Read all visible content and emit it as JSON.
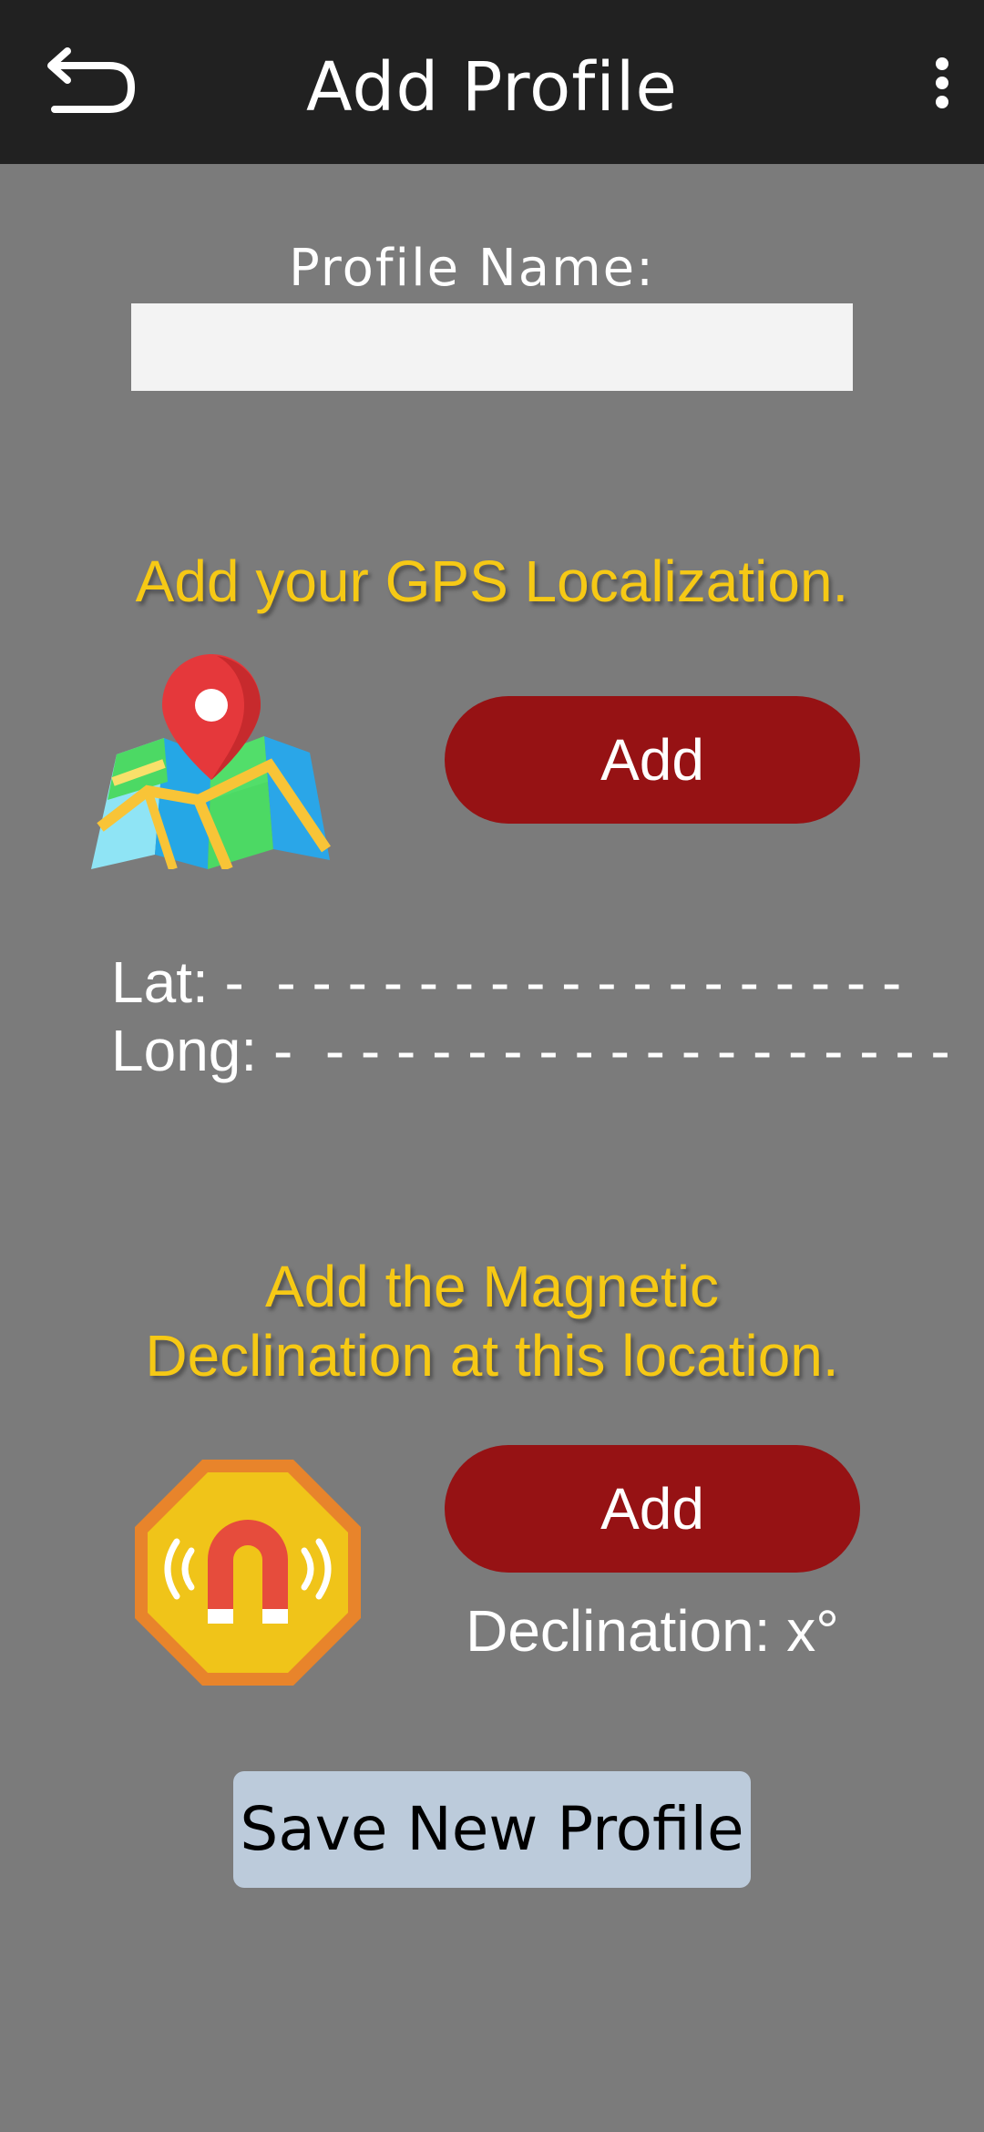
{
  "header": {
    "title": "Add Profile",
    "back_icon": "back-arrow-icon",
    "menu_icon": "more-vertical-icon"
  },
  "profile": {
    "label": "Profile Name:",
    "value": "",
    "placeholder": ""
  },
  "gps": {
    "heading": "Add your GPS Localization.",
    "icon": "map-pin-icon",
    "add_label": "Add",
    "lat_text": "Lat: -  - - - - - - - - - - - - - - - - - -",
    "long_text": "Long: -  - - - - - - - - - - - - - - - - - -"
  },
  "magnetic": {
    "heading_line1": "Add the Magnetic",
    "heading_line2": "Declination at this location.",
    "icon": "magnet-icon",
    "add_label": "Add",
    "declination_text": "Declination: x°"
  },
  "save_label": "Save New Profile",
  "colors": {
    "background": "#7b7b7b",
    "topbar": "#212121",
    "heading_yellow": "#f6c915",
    "add_button": "#961214",
    "save_button": "#bccbdb",
    "input_bg": "#f3f3f3"
  }
}
